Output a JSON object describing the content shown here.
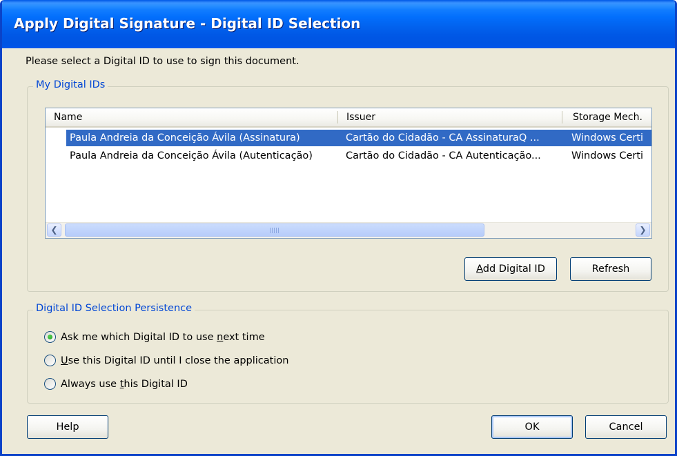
{
  "window": {
    "title": "Apply Digital Signature - Digital ID Selection"
  },
  "prompt": "Please select a Digital ID to use to sign this document.",
  "my_ids": {
    "legend": "My Digital IDs",
    "columns": [
      "Name",
      "Issuer",
      "Storage Mech."
    ],
    "rows": [
      {
        "name": "Paula Andreia da Conceição Ávila (Assinatura)",
        "issuer": "Cartão do Cidadão - CA AssinaturaQ ...",
        "storage": "Windows Certi",
        "selected": true
      },
      {
        "name": "Paula Andreia da Conceição Ávila (Autenticação)",
        "issuer": "Cartão do Cidadão - CA Autenticação...",
        "storage": "Windows Certi",
        "selected": false
      }
    ],
    "scroll_left_icon": "chevron-left",
    "scroll_right_icon": "chevron-right"
  },
  "buttons": {
    "add_digital_id": {
      "mnemonic": "A",
      "rest": "dd Digital ID"
    },
    "refresh": "Refresh",
    "help": "Help",
    "ok": "OK",
    "cancel": "Cancel"
  },
  "persistence": {
    "legend": "Digital ID Selection Persistence",
    "options": [
      {
        "pre": "Ask me which Digital ID to use ",
        "mn": "n",
        "post": "ext time",
        "checked": true
      },
      {
        "pre": "",
        "mn": "U",
        "post": "se this Digital ID until I close the application",
        "checked": false
      },
      {
        "pre": "Always use ",
        "mn": "t",
        "post": "his Digital ID",
        "checked": false
      }
    ]
  },
  "colors": {
    "titlebar": "#0054e3",
    "selection": "#316ac5",
    "legend_text": "#0046d5",
    "dialog_bg": "#ece9d8"
  }
}
